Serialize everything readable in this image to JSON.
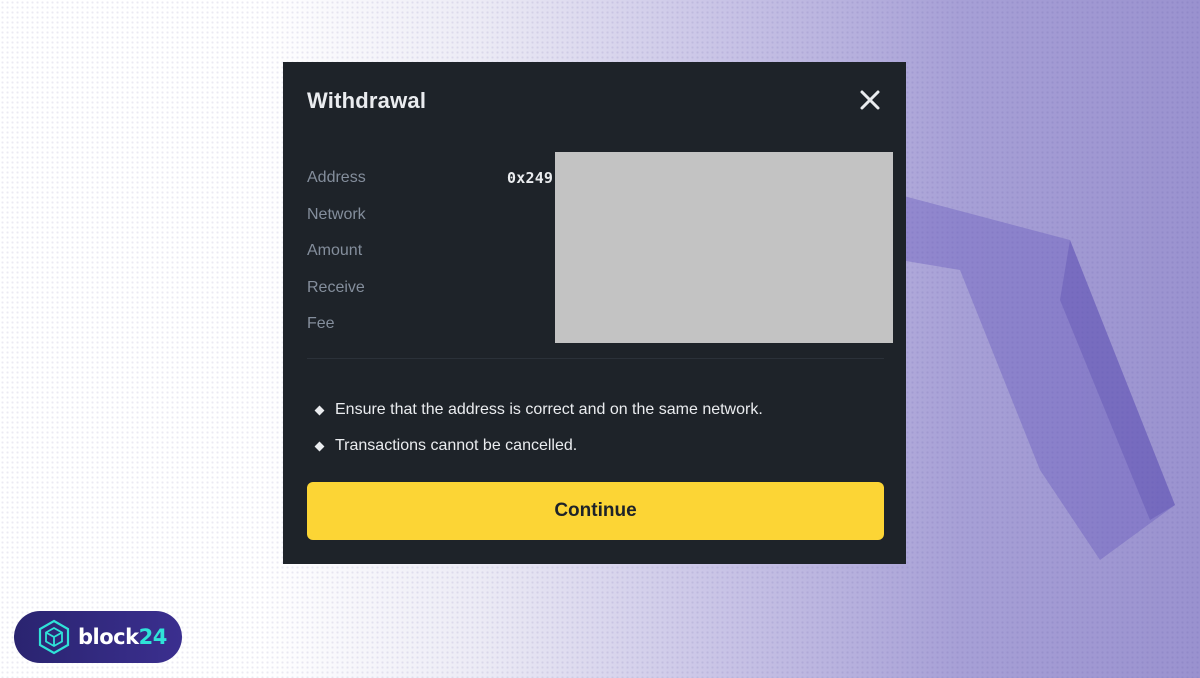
{
  "modal": {
    "title": "Withdrawal",
    "details": [
      {
        "label": "Address",
        "value": "0x249"
      },
      {
        "label": "Network",
        "value": ""
      },
      {
        "label": "Amount",
        "value": ""
      },
      {
        "label": "Receive",
        "value": ""
      },
      {
        "label": "Fee",
        "value": ""
      }
    ],
    "notes": [
      "Ensure that the address is correct and on the same network.",
      "Transactions cannot be cancelled."
    ],
    "continue_label": "Continue"
  },
  "brand": {
    "name_main": "block",
    "name_accent": "24",
    "icon": "hexagon-cube-icon"
  },
  "colors": {
    "modal_bg": "#1e2329",
    "label": "#848e9c",
    "text": "#eaecef",
    "button": "#fcd535",
    "redaction": "#c3c3c3",
    "brand_accent": "#2fe3d8"
  },
  "icons": {
    "close": "close-icon",
    "bullet": "diamond-bullet-icon"
  }
}
